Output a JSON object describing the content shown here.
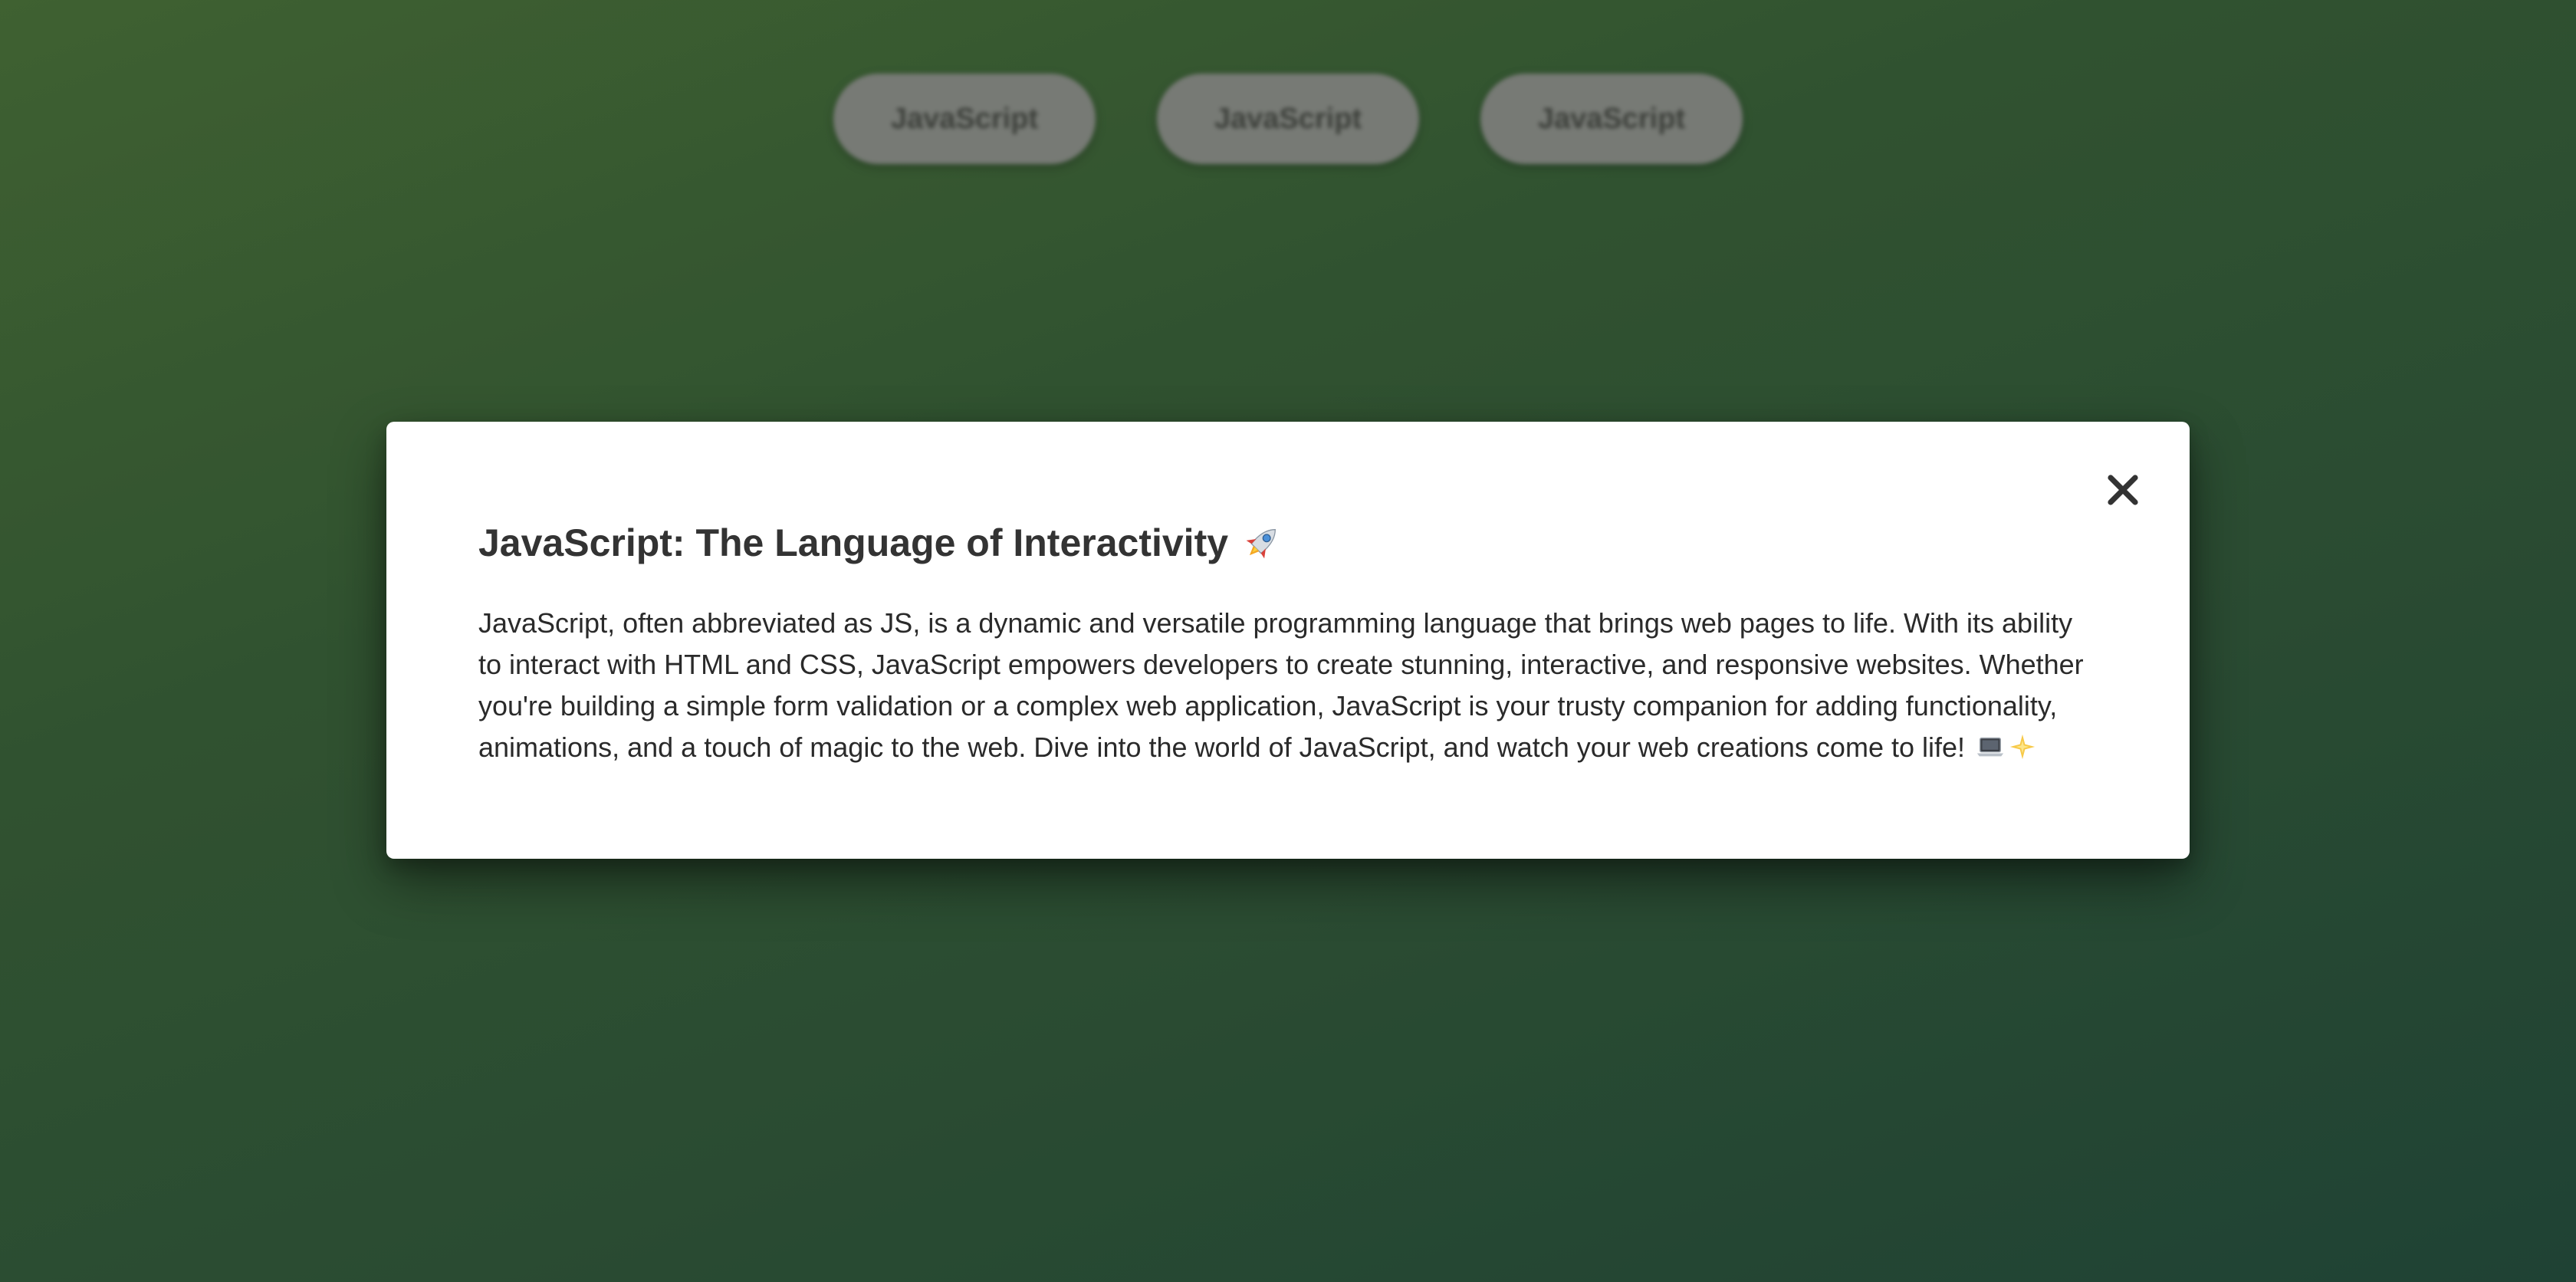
{
  "background": {
    "tabs": [
      {
        "label": "JavaScript"
      },
      {
        "label": "JavaScript"
      },
      {
        "label": "JavaScript"
      }
    ]
  },
  "modal": {
    "title": "JavaScript: The Language of Interactivity",
    "title_icon": "rocket-icon",
    "body": "JavaScript, often abbreviated as JS, is a dynamic and versatile programming language that brings web pages to life. With its ability to interact with HTML and CSS, JavaScript empowers developers to create stunning, interactive, and responsive websites. Whether you're building a simple form validation or a complex web application, JavaScript is your trusty companion for adding functionality, animations, and a touch of magic to the web. Dive into the world of JavaScript, and watch your web creations come to life!",
    "body_icons": [
      "laptop-icon",
      "sparkle-icon"
    ],
    "close_icon": "close-icon"
  },
  "colors": {
    "background_start": "#476b37",
    "background_end": "#22473a",
    "modal_background": "#ffffff",
    "text": "#333333"
  }
}
